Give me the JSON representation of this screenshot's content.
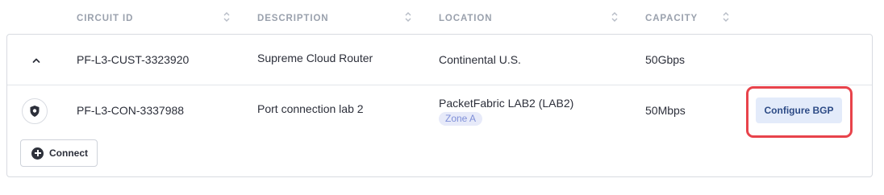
{
  "columns": [
    {
      "label": "CIRCUIT ID"
    },
    {
      "label": "DESCRIPTION"
    },
    {
      "label": "LOCATION"
    },
    {
      "label": "CAPACITY"
    }
  ],
  "rows": [
    {
      "expand_icon": "chevron-up-icon",
      "circuit_id": "PF-L3-CUST-3323920",
      "description": "Supreme Cloud Router",
      "location": "Continental U.S.",
      "capacity": "50Gbps"
    },
    {
      "icon": "shield-icon",
      "circuit_id": "PF-L3-CON-3337988",
      "description": "Port connection lab 2",
      "location": "PacketFabric LAB2 (LAB2)",
      "zone": "Zone A",
      "capacity": "50Mbps",
      "action_label": "Configure BGP"
    }
  ],
  "connect_label": "Connect",
  "highlight_color": "#e8434b",
  "accent_color": "#2d4b86"
}
